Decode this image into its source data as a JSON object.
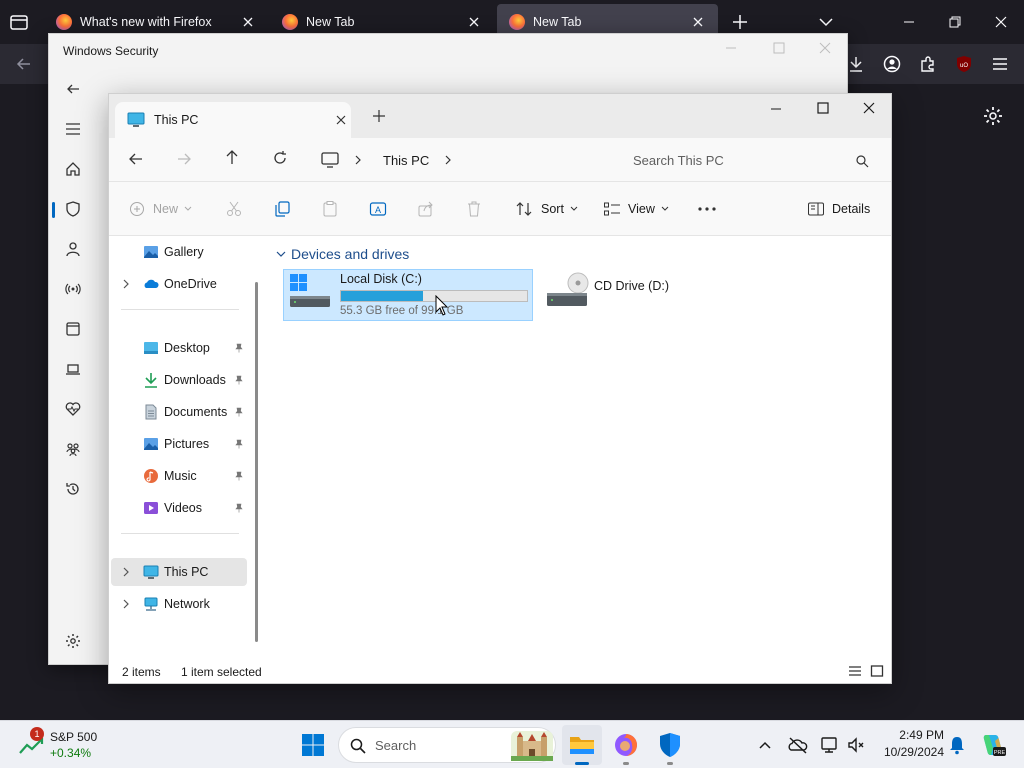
{
  "firefox": {
    "tabs": [
      {
        "label": "What's new with Firefox"
      },
      {
        "label": "New Tab"
      },
      {
        "label": "New Tab"
      }
    ]
  },
  "windows_security": {
    "title": "Windows Security"
  },
  "explorer": {
    "tab_title": "This PC",
    "address": {
      "location": "This PC"
    },
    "search": {
      "placeholder": "Search This PC"
    },
    "commands": {
      "new": "New",
      "sort": "Sort",
      "view": "View",
      "details": "Details"
    },
    "nav": {
      "gallery": "Gallery",
      "onedrive": "OneDrive",
      "desktop": "Desktop",
      "downloads": "Downloads",
      "documents": "Documents",
      "pictures": "Pictures",
      "music": "Music",
      "videos": "Videos",
      "this_pc": "This PC",
      "network": "Network"
    },
    "section_title": "Devices and drives",
    "drives": [
      {
        "name": "Local Disk (C:)",
        "free_text": "55.3 GB free of 99.1 GB",
        "used_fraction": 0.44
      },
      {
        "name": "CD Drive (D:)"
      }
    ],
    "status": {
      "items": "2 items",
      "selected": "1 item selected"
    }
  },
  "taskbar": {
    "widget": {
      "name": "S&P 500",
      "change": "+0.34%",
      "badge": "1"
    },
    "search_placeholder": "Search",
    "clock": {
      "time": "2:49 PM",
      "date": "10/29/2024"
    }
  },
  "colors": {
    "accent": "#0067c0",
    "selection": "#cce8ff",
    "progress": "#26a0da"
  }
}
